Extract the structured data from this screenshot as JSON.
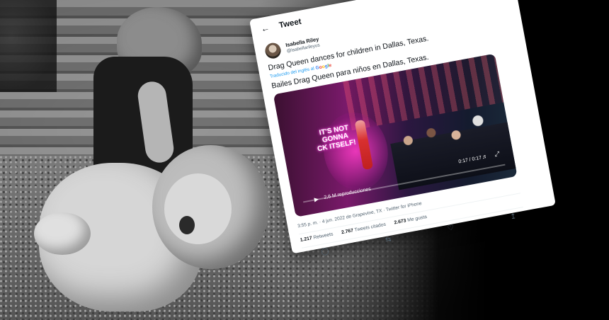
{
  "tweet": {
    "header_title": "Tweet",
    "author_name": "Isabella Riley",
    "author_handle": "@isabellarileyus",
    "text_original": "Drag Queen dances for children in Dallas, Texas.",
    "translated_from": "Traducido del inglés al",
    "translator_brand": [
      "G",
      "o",
      "o",
      "g",
      "l",
      "e"
    ],
    "text_translated": "Bailes Drag Queen para niños en Dallas, Texas.",
    "video": {
      "sign_lines": [
        "IT'S NOT",
        "GONNA",
        "CK ITSELF!"
      ],
      "counter": "0:17 / 0:17",
      "views": "2,6 M reproducciones"
    },
    "meta": "3:55 p. m. · 4 jun. 2022 de Grapevine, TX · Twitter for iPhone",
    "stats": {
      "retweets_count": "1.217",
      "retweets_label": "Retweets",
      "quotes_count": "2.767",
      "quotes_label": "Tweets citados",
      "likes_count": "2.673",
      "likes_label": "Me gusta"
    }
  },
  "colors": {
    "link_blue": "#1d9bf0",
    "muted_text": "#536471",
    "google": [
      "#4285f4",
      "#ea4335",
      "#fbbc05",
      "#4285f4",
      "#34a853",
      "#ea4335"
    ]
  },
  "icons": {
    "back": "arrow-left",
    "reply": "speech-bubble",
    "retweet": "loop-arrows",
    "like": "heart",
    "share": "upload-arrow",
    "play": "play-triangle",
    "volume": "speaker",
    "fullscreen": "expand-arrows"
  }
}
